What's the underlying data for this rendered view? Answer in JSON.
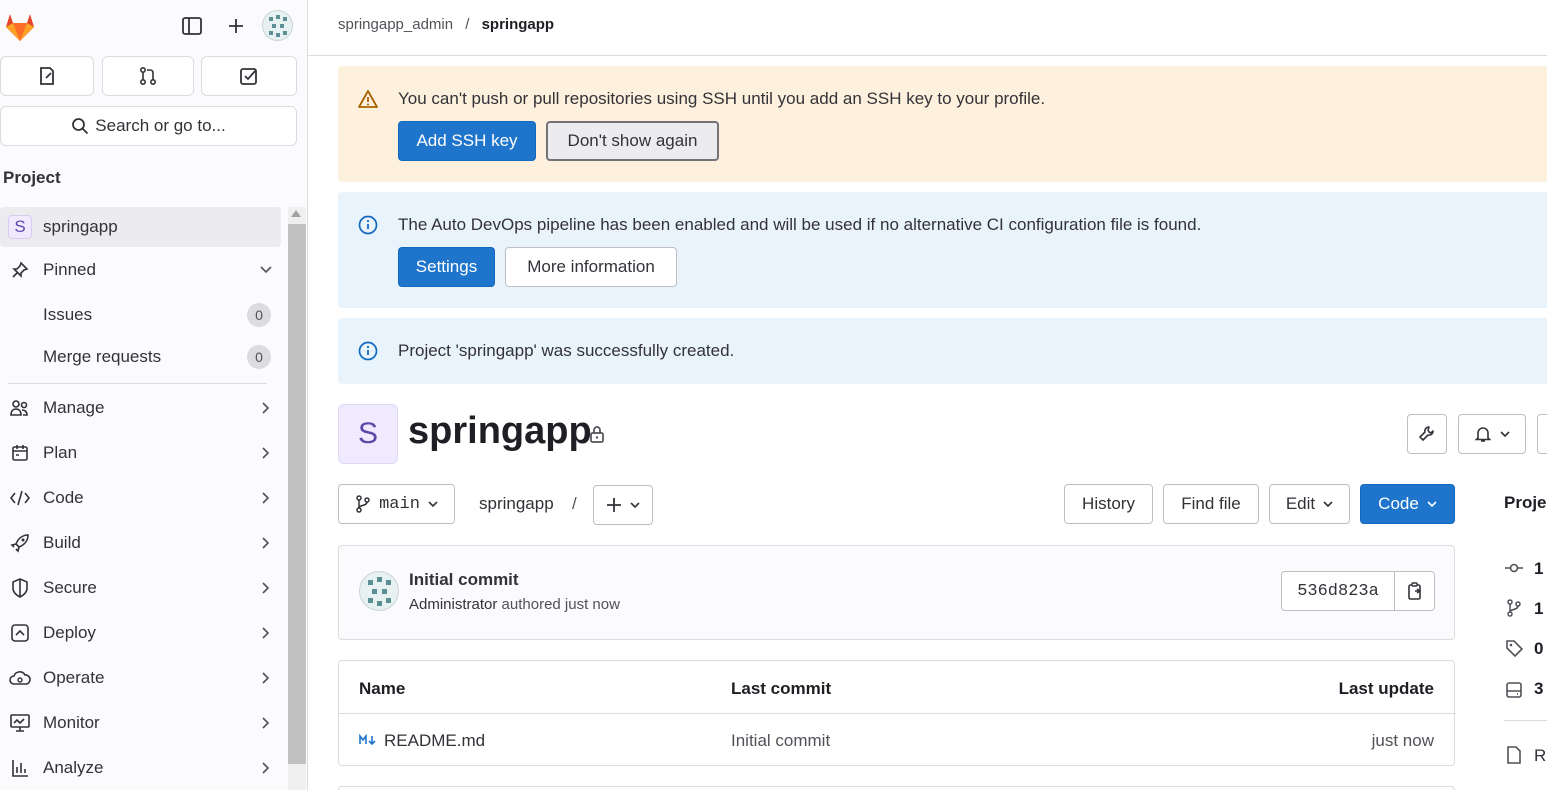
{
  "breadcrumb": {
    "parent": "springapp_admin",
    "separator": "/",
    "current": "springapp"
  },
  "sidebar": {
    "search_label": "Search or go to...",
    "section_title": "Project",
    "project_initial": "S",
    "project_name": "springapp",
    "pinned_label": "Pinned",
    "pinned_items": [
      {
        "label": "Issues",
        "count": "0"
      },
      {
        "label": "Merge requests",
        "count": "0"
      }
    ],
    "nav_items": [
      {
        "label": "Manage",
        "icon": "users-icon"
      },
      {
        "label": "Plan",
        "icon": "calendar-icon"
      },
      {
        "label": "Code",
        "icon": "code-icon"
      },
      {
        "label": "Build",
        "icon": "rocket-icon"
      },
      {
        "label": "Secure",
        "icon": "shield-icon"
      },
      {
        "label": "Deploy",
        "icon": "deploy-icon"
      },
      {
        "label": "Operate",
        "icon": "cloud-icon"
      },
      {
        "label": "Monitor",
        "icon": "monitor-icon"
      },
      {
        "label": "Analyze",
        "icon": "chart-icon"
      }
    ]
  },
  "alerts": {
    "ssh": {
      "message": "You can't push or pull repositories using SSH until you add an SSH key to your profile.",
      "primary": "Add SSH key",
      "secondary": "Don't show again"
    },
    "devops": {
      "message": "The Auto DevOps pipeline has been enabled and will be used if no alternative CI configuration file is found.",
      "primary": "Settings",
      "secondary": "More information"
    },
    "created": {
      "message": "Project 'springapp' was successfully created."
    }
  },
  "project": {
    "initial": "S",
    "title": "springapp"
  },
  "repo_toolbar": {
    "branch": "main",
    "path": "springapp",
    "path_sep": "/",
    "history": "History",
    "find_file": "Find file",
    "edit": "Edit",
    "code": "Code"
  },
  "commit": {
    "title": "Initial commit",
    "author": "Administrator",
    "authored": "authored just now",
    "sha": "536d823a"
  },
  "files_table": {
    "headers": {
      "name": "Name",
      "last_commit": "Last commit",
      "last_update": "Last update"
    },
    "rows": [
      {
        "name": "README.md",
        "last_commit": "Initial commit",
        "last_update": "just now"
      }
    ]
  },
  "side_panel": {
    "title": "Proje",
    "stats": [
      "1",
      "1",
      "0",
      "3"
    ],
    "readme": "RI"
  },
  "colors": {
    "primary": "#1f75cb",
    "warning_bg": "#fdf1dd",
    "info_bg": "#e9f3fc",
    "sidebar_bg": "#fbfafd"
  }
}
